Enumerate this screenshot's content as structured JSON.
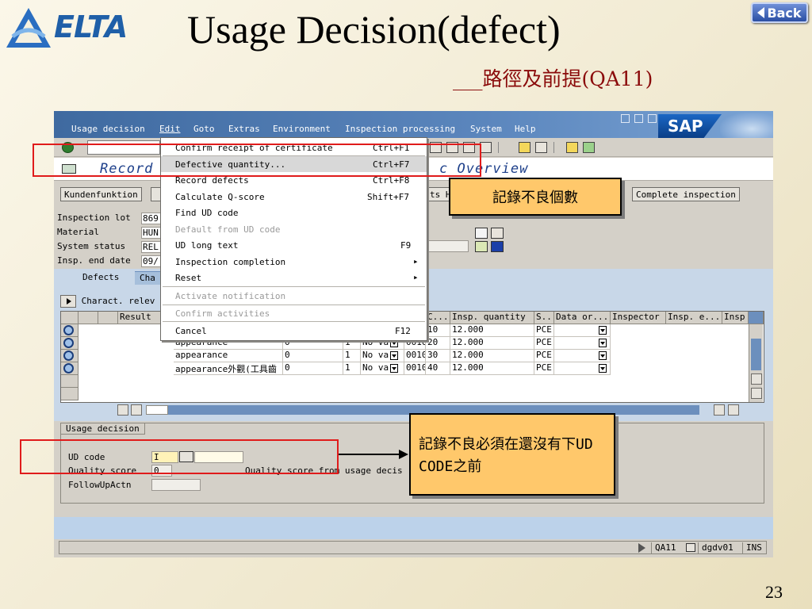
{
  "slide": {
    "title": "Usage Decision(defect)",
    "subtitle": "___路徑及前提(QA11)",
    "logo_text": "ELTA",
    "back_label": "Back",
    "page_number": "23"
  },
  "sap": {
    "menubar": [
      "Usage decision",
      "Edit",
      "Goto",
      "Extras",
      "Environment",
      "Inspection processing",
      "System",
      "Help"
    ],
    "active_menu": "Edit",
    "logo": "SAP",
    "screen_title_left": "Record",
    "screen_title_right": "c Overview",
    "app_buttons": {
      "kundenfunktion": "Kundenfunktion",
      "ts": "ts H",
      "complete_inspection": "Complete inspection"
    },
    "header_fields": [
      {
        "label": "Inspection lot",
        "value": "869"
      },
      {
        "label": "Material",
        "value": "HUN"
      },
      {
        "label": "System status",
        "value": "REL"
      },
      {
        "label": "Insp. end date",
        "value": "09/"
      }
    ],
    "tabs": {
      "defects": "Defects",
      "characteristics": "Cha"
    },
    "charact_label": "Charact. relev",
    "grid": {
      "headers": {
        "result": "Result",
        "c": "C...",
        "insp_qty": "Insp. quantity",
        "s": "S..",
        "data_origin": "Data or...",
        "inspector": "Inspector",
        "insp_e": "Insp. e...",
        "insp": "Insp"
      },
      "rows": [
        {
          "desc": "",
          "v1": "",
          "v2": "",
          "text": "",
          "proc": "",
          "c": "10",
          "qty": "12.000",
          "uom": "PCE"
        },
        {
          "desc": "appearance",
          "v1": "0",
          "v2": "1",
          "text": "No va",
          "proc": "0010",
          "c": "20",
          "qty": "12.000",
          "uom": "PCE"
        },
        {
          "desc": "appearance",
          "v1": "0",
          "v2": "1",
          "text": "No va",
          "proc": "0010",
          "c": "30",
          "qty": "12.000",
          "uom": "PCE"
        },
        {
          "desc": "appearance外觀(工具齒",
          "v1": "0",
          "v2": "1",
          "text": "No va",
          "proc": "0010",
          "c": "40",
          "qty": "12.000",
          "uom": "PCE"
        }
      ]
    },
    "usage_decision": {
      "tab": "Usage decision",
      "ud_code_label": "UD code",
      "ud_code_value": "I",
      "quality_score_label": "Quality score",
      "quality_score_value": "0",
      "quality_score_desc": "Quality score from usage decis",
      "followup_label": "FollowUpActn"
    },
    "status_bar": {
      "tcode": "QA11",
      "server": "dgdv01",
      "mode": "INS"
    }
  },
  "edit_menu": [
    {
      "label": "Confirm receipt of certificate",
      "accel": "Ctrl+F1",
      "disabled": false
    },
    {
      "label": "Defective quantity...",
      "accel": "Ctrl+F7",
      "disabled": false,
      "highlighted": true
    },
    {
      "label": "Record defects",
      "accel": "Ctrl+F8",
      "disabled": false
    },
    {
      "label": "Calculate Q-score",
      "accel": "Shift+F7",
      "disabled": false
    },
    {
      "label": "Find UD code",
      "accel": "",
      "disabled": false
    },
    {
      "label": "Default from UD code",
      "accel": "",
      "disabled": true
    },
    {
      "label": "UD long text",
      "accel": "F9",
      "disabled": false
    },
    {
      "label": "Inspection completion",
      "accel": "",
      "disabled": false,
      "submenu": true
    },
    {
      "label": "Reset",
      "accel": "",
      "disabled": false,
      "submenu": true
    },
    {
      "label": "Activate notification",
      "accel": "",
      "disabled": true
    },
    {
      "label": "Confirm activities",
      "accel": "",
      "disabled": true
    },
    {
      "label": "Cancel",
      "accel": "F12",
      "disabled": false
    }
  ],
  "callouts": {
    "defect_qty": "記錄不良個數",
    "before_ud": "記錄不良必須在還沒有下UD CODE之前"
  },
  "colors": {
    "annotation_red": "#e01b1b",
    "callout_fill": "#ffc86b",
    "sap_blue": "#3f6aa0"
  }
}
